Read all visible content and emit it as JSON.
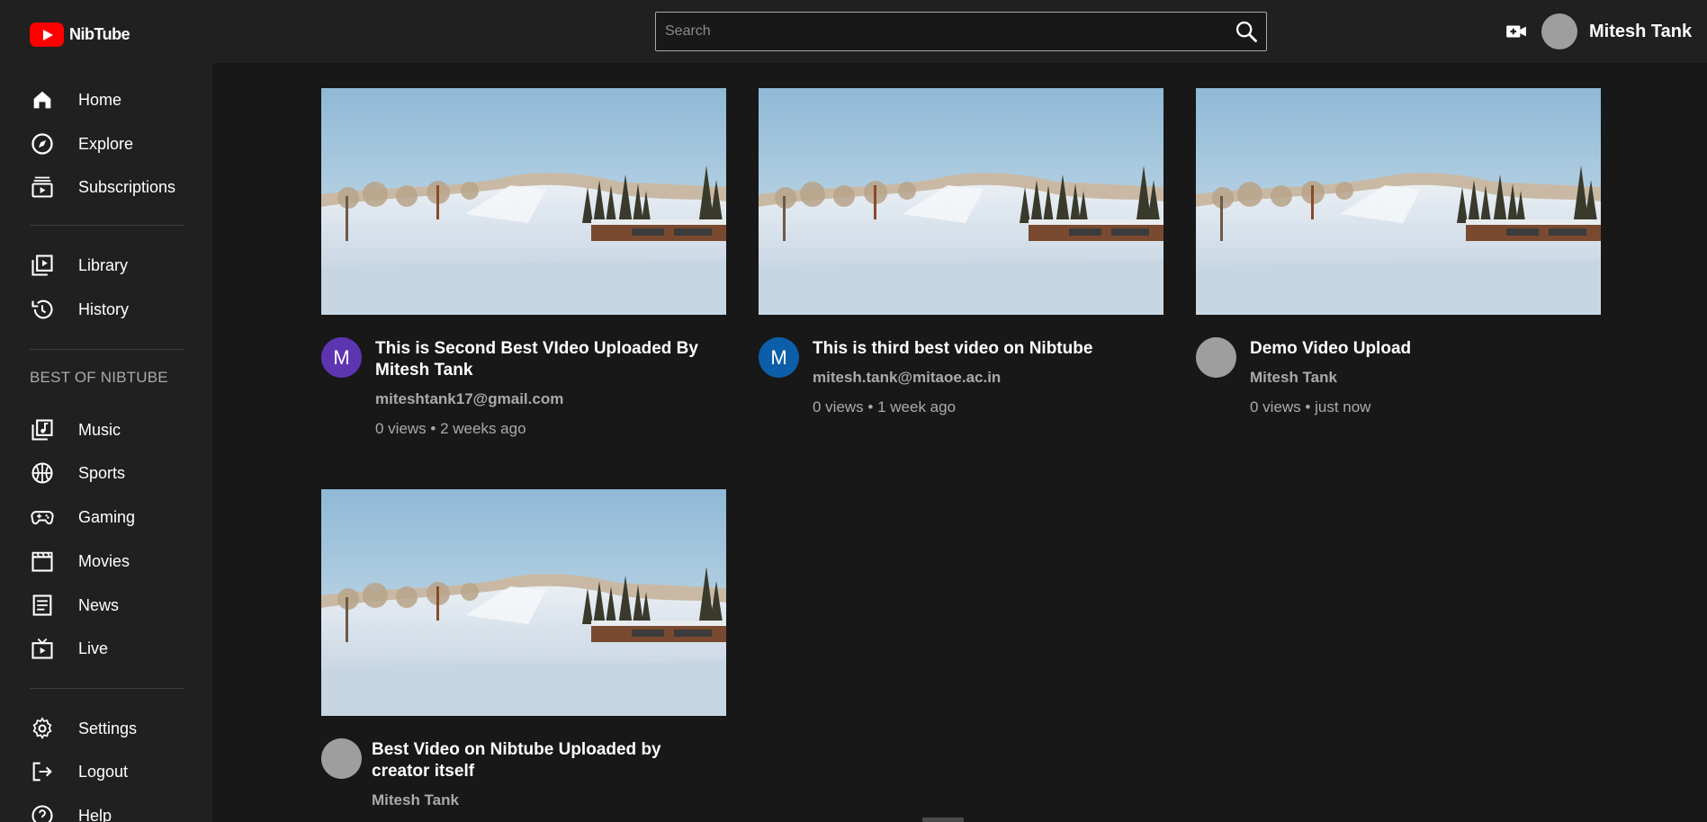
{
  "app": {
    "name": "NibTube"
  },
  "header": {
    "search_placeholder": "Search",
    "user_name": "Mitesh Tank"
  },
  "sidebar": {
    "primary": [
      {
        "label": "Home",
        "icon": "home-icon"
      },
      {
        "label": "Explore",
        "icon": "compass-icon"
      },
      {
        "label": "Subscriptions",
        "icon": "subscriptions-icon"
      }
    ],
    "secondary": [
      {
        "label": "Library",
        "icon": "library-icon"
      },
      {
        "label": "History",
        "icon": "history-icon"
      }
    ],
    "best_of_title": "BEST OF NIBTUBE",
    "best_of": [
      {
        "label": "Music",
        "icon": "music-icon"
      },
      {
        "label": "Sports",
        "icon": "sports-icon"
      },
      {
        "label": "Gaming",
        "icon": "gaming-icon"
      },
      {
        "label": "Movies",
        "icon": "movies-icon"
      },
      {
        "label": "News",
        "icon": "news-icon"
      },
      {
        "label": "Live",
        "icon": "live-icon"
      }
    ],
    "footer": [
      {
        "label": "Settings",
        "icon": "settings-icon"
      },
      {
        "label": "Logout",
        "icon": "logout-icon"
      },
      {
        "label": "Help",
        "icon": "help-icon"
      }
    ]
  },
  "videos": [
    {
      "title": "This is Second Best VIdeo Uploaded By Mitesh Tank",
      "channel": "miteshtank17@gmail.com",
      "views": "0 views",
      "age": "2 weeks ago",
      "avatar_letter": "M",
      "avatar_color": "#5e35b1"
    },
    {
      "title": "This is third best video on Nibtube",
      "channel": "mitesh.tank@mitaoe.ac.in",
      "views": "0 views",
      "age": "1 week ago",
      "avatar_letter": "M",
      "avatar_color": "#0d5ea8"
    },
    {
      "title": "Demo Video Upload",
      "channel": "Mitesh Tank",
      "views": "0 views",
      "age": "just now",
      "avatar_letter": "",
      "avatar_color": "#9e9e9e"
    },
    {
      "title": "Best Video on Nibtube Uploaded by creator itself",
      "channel": "Mitesh Tank",
      "views": "",
      "age": "",
      "avatar_letter": "",
      "avatar_color": "#9e9e9e"
    }
  ],
  "colors": {
    "background": "#181818",
    "panel": "#202020",
    "brand_red": "#ff0000",
    "secondary_text": "#aaaaaa"
  }
}
